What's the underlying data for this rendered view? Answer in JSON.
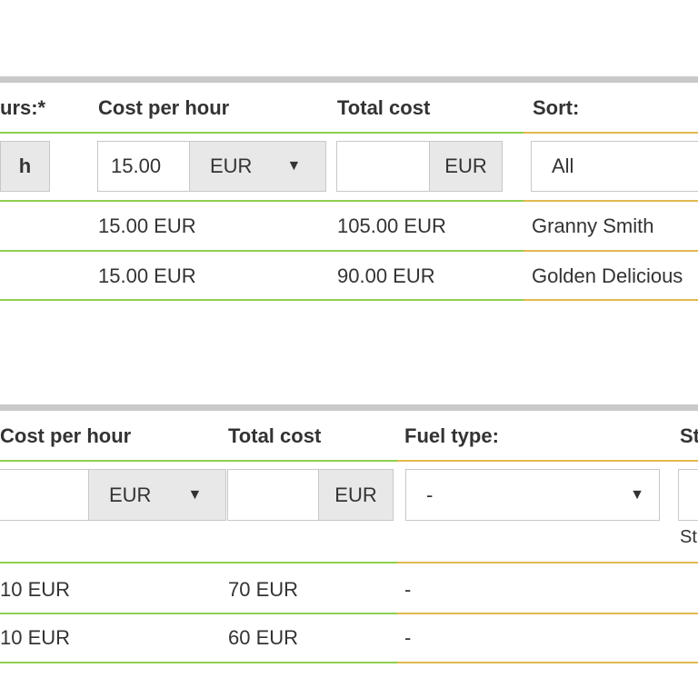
{
  "table1": {
    "headers": {
      "hours": "urs:*",
      "cost_per_hour": "Cost per hour",
      "total_cost": "Total cost",
      "sort": "Sort:"
    },
    "filters": {
      "hours_unit": "h",
      "cost_value": "15.00",
      "cost_currency": "EUR",
      "total_value": "",
      "total_currency": "EUR",
      "sort_value": "All"
    },
    "rows": [
      {
        "cost": "15.00 EUR",
        "total": "105.00 EUR",
        "sort": "Granny Smith"
      },
      {
        "cost": "15.00 EUR",
        "total": "90.00 EUR",
        "sort": "Golden Delicious"
      }
    ]
  },
  "table2": {
    "headers": {
      "cost_per_hour": "Cost per hour",
      "total_cost": "Total cost",
      "fuel_type": "Fuel type:",
      "st": "St"
    },
    "filters": {
      "cost_value": "",
      "cost_currency": "EUR",
      "total_value": "",
      "total_currency": "EUR",
      "fuel_value": "-",
      "st_sub": "St"
    },
    "rows": [
      {
        "cost": "10 EUR",
        "total": "70 EUR",
        "fuel": "-"
      },
      {
        "cost": "10 EUR",
        "total": "60 EUR",
        "fuel": "-"
      }
    ]
  },
  "colors": {
    "green_border": "#8fcf4f",
    "orange_border": "#e3b94f",
    "grey_bar": "#c9c9c9"
  }
}
